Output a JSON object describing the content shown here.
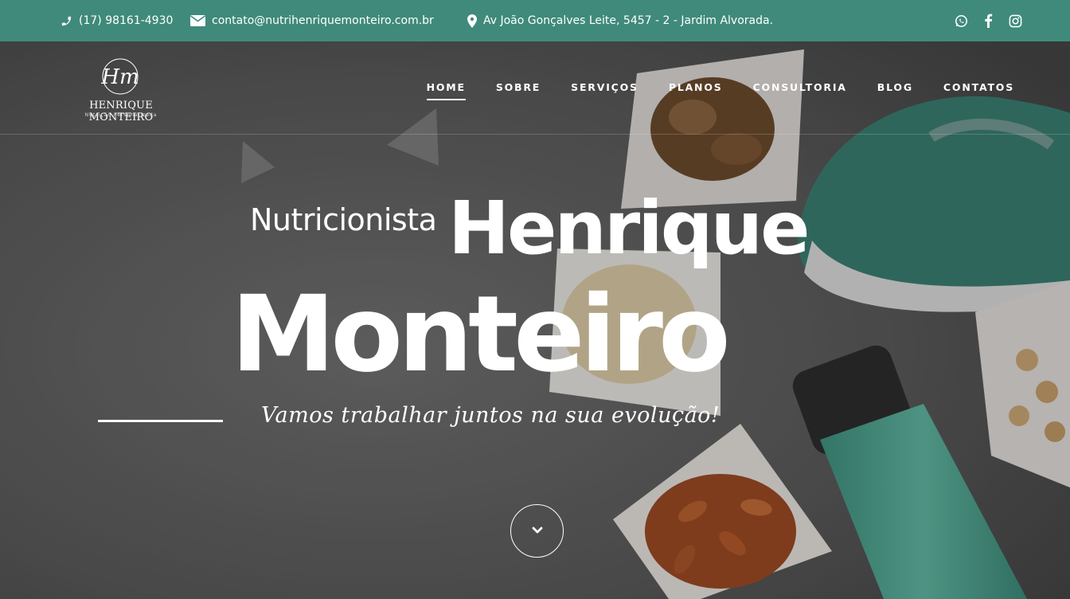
{
  "topbar": {
    "phone": "(17) 98161-4930",
    "email": "contato@nutrihenriquemonteiro.com.br",
    "address": "Av João Gonçalves Leite, 5457 - 2 - Jardim Alvorada.",
    "social_icons": [
      "whatsapp-icon",
      "facebook-icon",
      "instagram-icon"
    ],
    "bg_color": "#3f8a7b"
  },
  "logo": {
    "monogram": "Hm",
    "name": "HENRIQUE MONTEIRO",
    "subtitle": "Nutrição Personalizada"
  },
  "nav": {
    "items": [
      {
        "label": "HOME",
        "active": true
      },
      {
        "label": "SOBRE"
      },
      {
        "label": "SERVIÇOS"
      },
      {
        "label": "PLANOS"
      },
      {
        "label": "CONSULTORIA"
      },
      {
        "label": "BLOG"
      },
      {
        "label": "CONTATOS"
      }
    ]
  },
  "hero": {
    "kicker": "Nutricionista",
    "name_line1": "Henrique",
    "name_line2": "Monteiro",
    "tagline": "Vamos trabalhar juntos na sua evolução!",
    "scroll_icon": "chevron-down-icon"
  }
}
